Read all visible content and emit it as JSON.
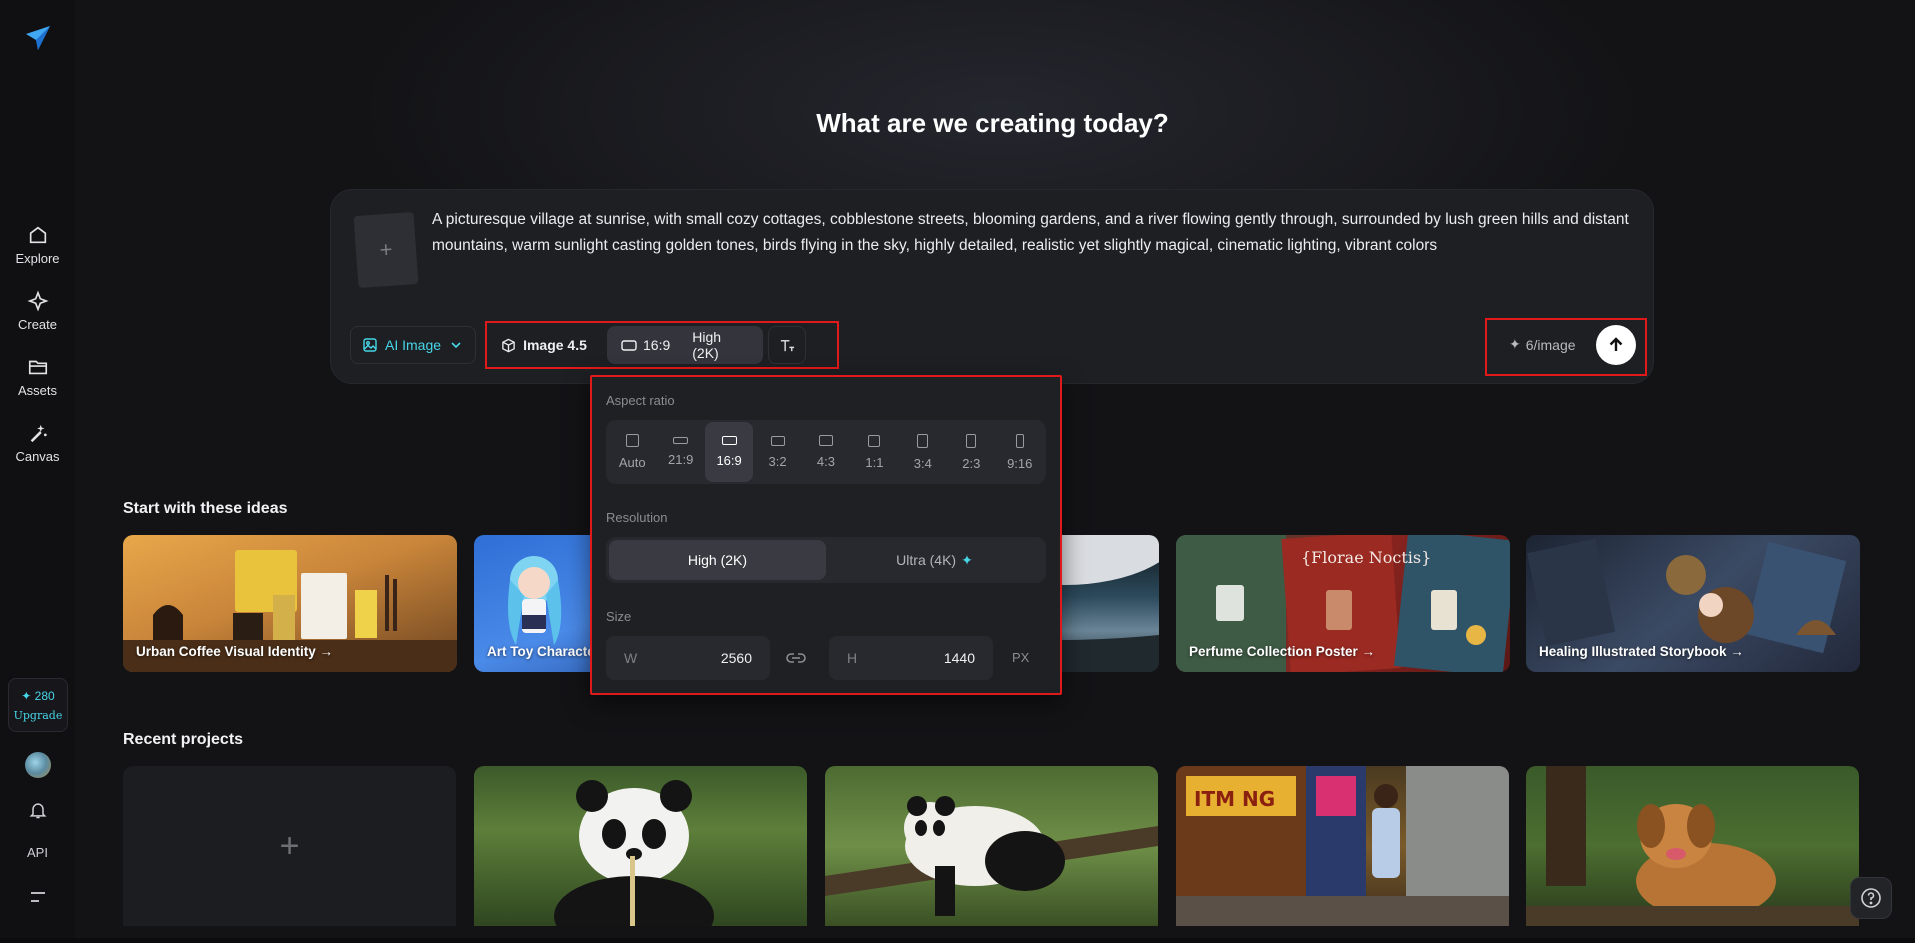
{
  "sidebar": {
    "items": [
      {
        "label": "Explore",
        "icon": "home-icon"
      },
      {
        "label": "Create",
        "icon": "sparkle-icon"
      },
      {
        "label": "Assets",
        "icon": "folder-icon"
      },
      {
        "label": "Canvas",
        "icon": "magic-wand-icon"
      }
    ],
    "credits": "280",
    "upgrade_label": "Upgrade",
    "api_label": "API"
  },
  "heading": "What are we creating today?",
  "prompt": {
    "text": "A picturesque village at sunrise, with small cozy cottages, cobblestone streets, blooming gardens, and a river flowing gently through, surrounded by lush green hills and distant mountains, warm sunlight casting golden tones, birds flying in the sky, highly detailed, realistic yet slightly magical, cinematic lighting, vibrant colors",
    "mode_label": "AI Image",
    "model_label": "Image 4.5",
    "ratio_label": "16:9",
    "resolution_label": "High (2K)",
    "cost_label": "6/image"
  },
  "popover": {
    "aspect_ratio_title": "Aspect ratio",
    "ratios": [
      "Auto",
      "21:9",
      "16:9",
      "3:2",
      "4:3",
      "1:1",
      "3:4",
      "2:3",
      "9:16"
    ],
    "selected_ratio": "16:9",
    "resolution_title": "Resolution",
    "resolution_high": "High (2K)",
    "resolution_ultra": "Ultra (4K)",
    "size_title": "Size",
    "width_label": "W",
    "width_value": "2560",
    "height_label": "H",
    "height_value": "1440",
    "unit": "PX"
  },
  "ideas": {
    "title": "Start with these ideas",
    "cards": [
      "Urban Coffee Visual Identity →",
      "Art Toy Characte",
      "",
      "Perfume Collection Poster →",
      "Healing Illustrated Storybook →"
    ]
  },
  "recent": {
    "title": "Recent projects"
  },
  "colors": {
    "accent": "#47d6e8",
    "highlight": "#e01a1a",
    "background": "#131316"
  }
}
